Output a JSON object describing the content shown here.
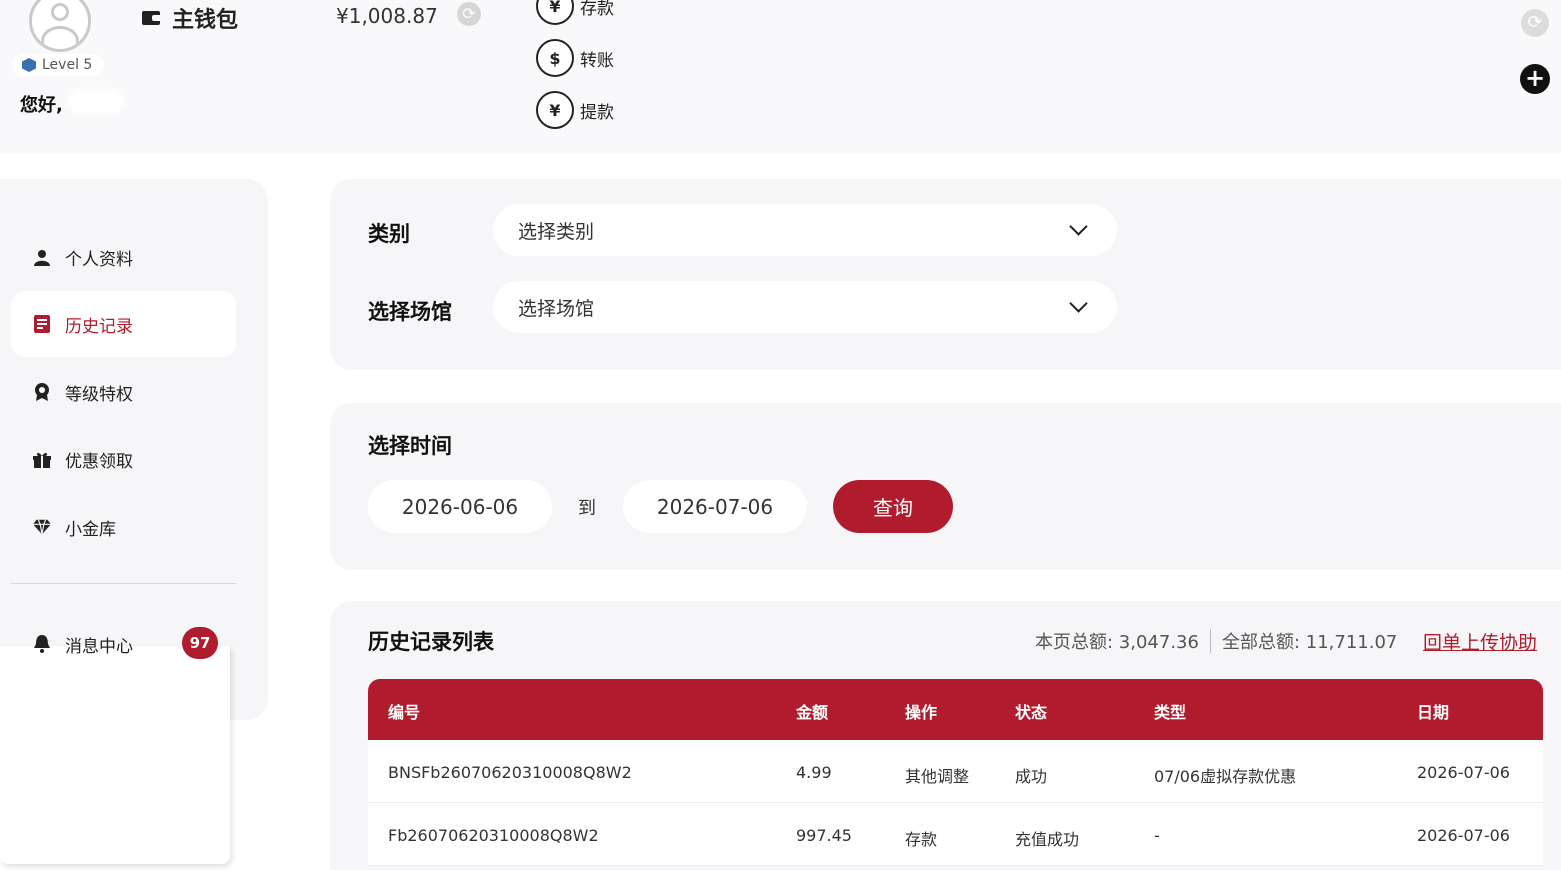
{
  "header": {
    "level": "Level 5",
    "greeting": "您好,",
    "wallet_title": "主钱包",
    "balance": "¥1,008.87",
    "actions": [
      {
        "label": "存款",
        "icon": "deposit-icon",
        "glyph": "¥"
      },
      {
        "label": "转账",
        "icon": "transfer-icon",
        "glyph": "$"
      },
      {
        "label": "提款",
        "icon": "withdraw-icon",
        "glyph": "¥"
      }
    ]
  },
  "sidebar": {
    "items": [
      {
        "label": "个人资料",
        "icon": "user-icon"
      },
      {
        "label": "历史记录",
        "icon": "document-icon"
      },
      {
        "label": "等级特权",
        "icon": "medal-icon"
      },
      {
        "label": "优惠领取",
        "icon": "gift-icon"
      },
      {
        "label": "小金库",
        "icon": "diamond-icon"
      }
    ],
    "messages": {
      "label": "消息中心",
      "count": "97",
      "icon": "bell-icon"
    }
  },
  "filters": {
    "category_label": "类别",
    "category_placeholder": "选择类别",
    "venue_label": "选择场馆",
    "venue_placeholder": "选择场馆"
  },
  "time": {
    "label": "选择时间",
    "start": "2026-06-06",
    "to": "到",
    "end": "2026-07-06",
    "query": "查询"
  },
  "history": {
    "title": "历史记录列表",
    "page_total": "本页总额: 3,047.36",
    "all_total": "全部总额: 11,711.07",
    "upload_link": "回单上传协助",
    "columns": [
      "编号",
      "金额",
      "操作",
      "状态",
      "类型",
      "日期"
    ],
    "rows": [
      [
        "BNSFb26070620310008Q8W2",
        "4.99",
        "其他调整",
        "成功",
        "07/06虚拟存款优惠",
        "2026-07-06"
      ],
      [
        "Fb26070620310008Q8W2",
        "997.45",
        "存款",
        "充值成功",
        "-",
        "2026-07-06"
      ]
    ]
  },
  "colors": {
    "accent": "#b01c2e",
    "panel": "#f6f6f8"
  }
}
